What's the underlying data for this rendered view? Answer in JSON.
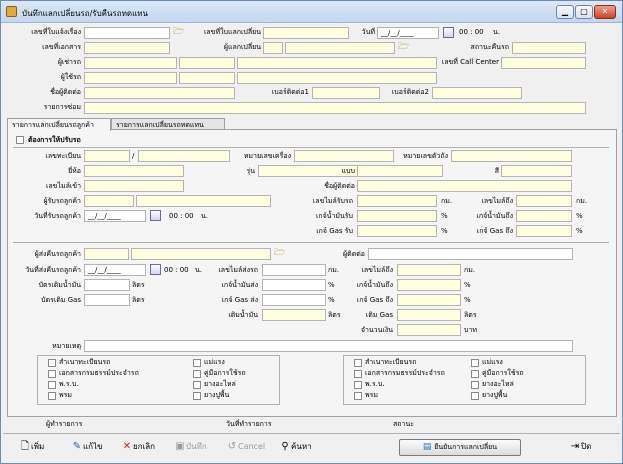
{
  "window": {
    "title": "บันทึกแลกเปลี่ยนรถ/รับคืนรถทดแทน",
    "min": "▁",
    "max": "□",
    "close": "✕"
  },
  "header": {
    "doc_no_label": "เลขที่ใบแจ้งเรื่อง",
    "swap_no_label": "เลขที่ใบแลกเปลี่ยน",
    "date_label": "วันที่",
    "date_value": "__/__/____",
    "time_value": "00 : 00",
    "time_unit": "น.",
    "doc_code_label": "เลขที่เอกสาร",
    "changer_label": "ผู้แลกเปลี่ยน",
    "status_label": "สถานะคืนรถ",
    "renter_label": "ผู้เช่ารถ",
    "call_center_label": "เลขที่ Call Center",
    "user_label": "ผู้ใช้รถ",
    "contact_label": "ชื่อผู้ติดต่อ",
    "phone1_label": "เบอร์ติดต่อ1",
    "phone2_label": "เบอร์ติดต่อ2",
    "detail_label": "รายการซ่อม"
  },
  "tabs": [
    {
      "label": "รายการแลกเปลี่ยนรถลูกค้า"
    },
    {
      "label": "รายการแลกเปลี่ยนรถทดแทน"
    }
  ],
  "upper": {
    "need_fix_label": "ต้องการให้ปรับรถ",
    "plate_label": "เลขทะเบียน",
    "slash": "/",
    "engine_label": "หมายเลขเครื่อง",
    "chassis_label": "หมายเลขตัวถัง",
    "brand_label": "ยี่ห้อ",
    "model_label": "รุ่น",
    "type_label": "แบบ",
    "color_label": "สี",
    "mileage_in_label": "เลขไมล์เข้า",
    "contact_name_label": "ชื่อผู้ติดต่อ",
    "receiver_label": "ผู้รับรถลูกค้า",
    "mile_recv_label": "เลขไมล์รับรถ",
    "km1": "กม.",
    "mile_to_label": "เลขไมล์ถึง",
    "km2": "กม.",
    "recv_date_label": "วันที่รับรถลูกค้า",
    "recv_date": "__/__/____",
    "recv_time": "00 : 00",
    "recv_time_unit": "น.",
    "fuel_recv_label": "เกจ์น้ำมันรับ",
    "pct1": "%",
    "fuel_to_label": "เกจ์น้ำมันถึง",
    "pct2": "%",
    "gas_recv_label": "เกจ์ Gas รับ",
    "pct3": "%",
    "gas_to_label": "เกจ์ Gas ถึง",
    "pct4": "%"
  },
  "lower": {
    "sender_label": "ผู้ส่งคืนรถลูกค้า",
    "contact_label": "ผู้ติดต่อ",
    "send_date_label": "วันที่ส่งคืนรถลูกค้า",
    "send_date": "__/__/____",
    "send_time": "00 : 00",
    "send_time_unit": "น.",
    "mile_send_label": "เลขไมล์ส่งรถ",
    "km1": "กม.",
    "mile_to_label": "เลขไมล์ถึง",
    "km2": "กม.",
    "fuel_fill_label": "บัตรเติมน้ำมัน",
    "liter1": "ลิตร",
    "fuel_send_label": "เกจ์น้ำมันส่ง",
    "pct1": "%",
    "fuel_to_label": "เกจ์น้ำมันถึง",
    "pct2": "%",
    "gas_fill_label": "บัตรเติม Gas",
    "liter2": "ลิตร",
    "gas_send_label": "เกจ์ Gas ส่ง",
    "pct3": "%",
    "gas_to_label": "เกจ์ Gas ถึง",
    "pct4": "%",
    "oil_fill_label": "เติมน้ำมัน",
    "liter3": "ลิตร",
    "gas_fill2_label": "เติม Gas",
    "liter4": "ลิตร",
    "amount_label": "จำนวนเงิน",
    "baht": "บาท",
    "note_label": "หมายเหตุ"
  },
  "checklist": {
    "items": [
      "สำเนาทะเบียนรถ",
      "เอกสารกรมธรรม์ประจำรถ",
      "พ.ร.บ.",
      "พรม"
    ],
    "items2": [
      "แม่แรง",
      "คู่มือการใช้รถ",
      "ยางอะไหล่",
      "ยางปูพื้น"
    ]
  },
  "footer": {
    "recorder_label": "ผู้ทำรายการ",
    "record_date_label": "วันที่ทำรายการ",
    "status_label": "สถานะ"
  },
  "toolbar": {
    "add": "เพิ่ม",
    "edit": "แก้ไข",
    "cancel_doc": "ยกเลิก",
    "save": "บันทึก",
    "cancel": "Cancel",
    "search": "ค้นหา",
    "confirm": "ยืนยันการแลกเปลี่ยน",
    "close": "ปิด"
  }
}
